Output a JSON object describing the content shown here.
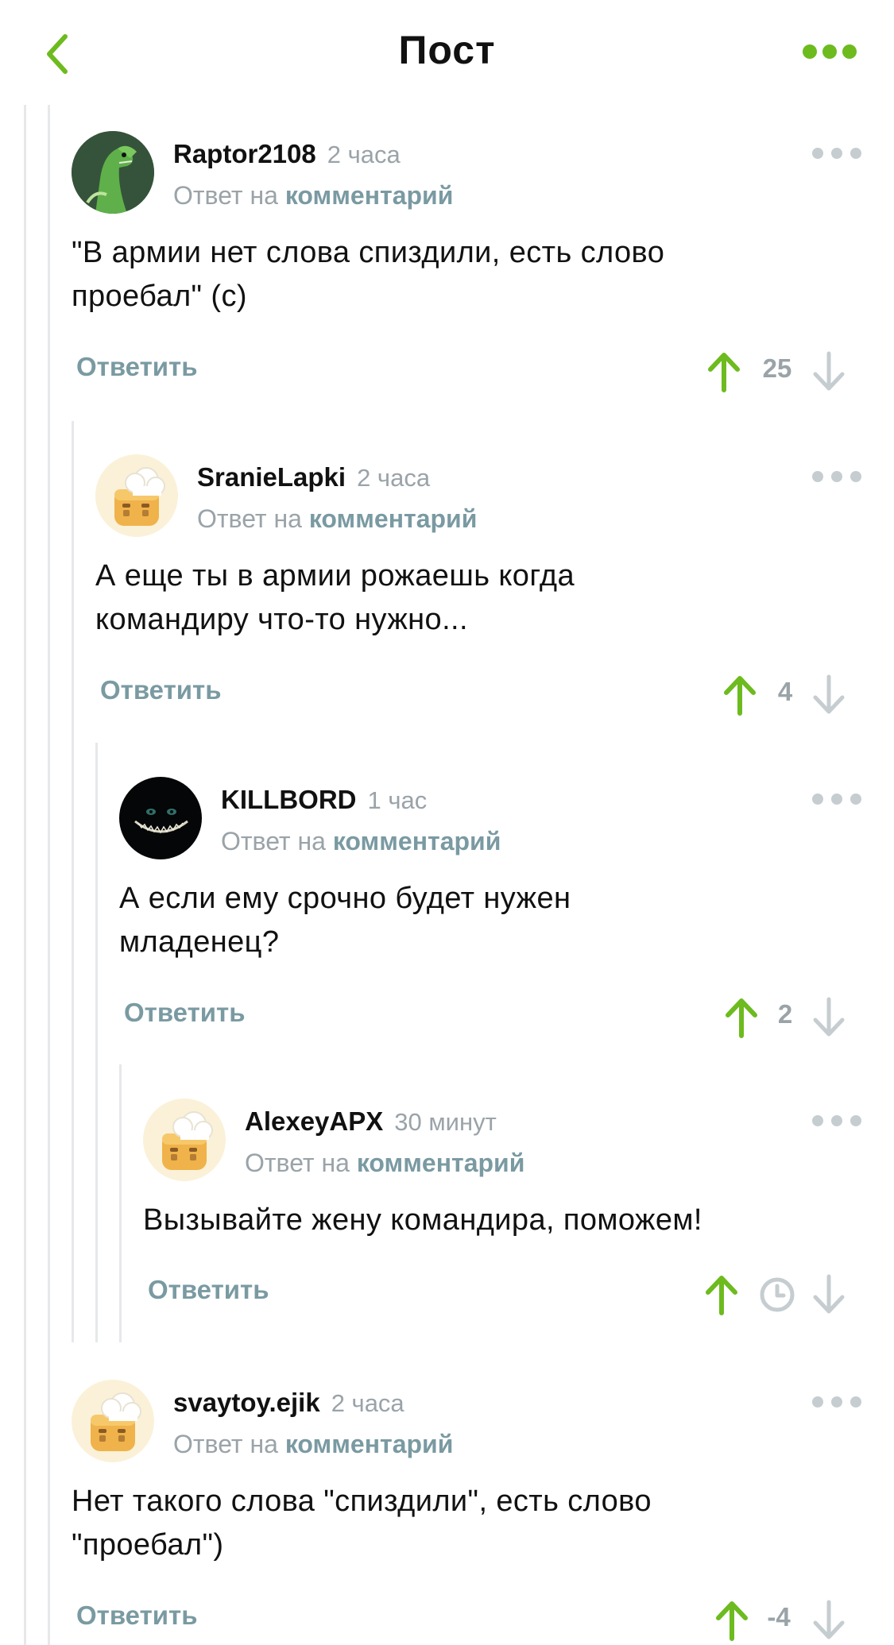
{
  "header": {
    "title": "Пост"
  },
  "colors": {
    "accent_green": "#6dbb1f",
    "muted_teal": "#7a9aa2",
    "muted_gray": "#9aa3a8",
    "thread_line": "#e6e8ea"
  },
  "comments": [
    {
      "username": "Raptor2108",
      "time": "2 часа",
      "reply_prefix": "Ответ на",
      "reply_link": "комментарий",
      "text_lines": [
        "\"В армии нет слова спиздили, есть слово",
        "проебал\" (с)"
      ],
      "reply_label": "Ответить",
      "rating": "25",
      "avatar": "dinosaur-avatar"
    },
    {
      "username": "SranieLapki",
      "time": "2 часа",
      "reply_prefix": "Ответ на",
      "reply_link": "комментарий",
      "text_lines": [
        "А еще ты в армии рожаешь когда",
        "командиру что-то нужно..."
      ],
      "reply_label": "Ответить",
      "rating": "4",
      "avatar": "default-chef-avatar"
    },
    {
      "username": "KILLBORD",
      "time": "1 час",
      "reply_prefix": "Ответ на",
      "reply_link": "комментарий",
      "text_lines": [
        "А если ему срочно будет нужен",
        "младенец?"
      ],
      "reply_label": "Ответить",
      "rating": "2",
      "avatar": "dark-smile-avatar"
    },
    {
      "username": "AlexeyAPX",
      "time": "30 минут",
      "reply_prefix": "Ответ на",
      "reply_link": "комментарий",
      "text_lines": [
        "Вызывайте жену командира, поможем!"
      ],
      "reply_label": "Ответить",
      "rating_icon": "clock-icon",
      "avatar": "default-chef-avatar"
    },
    {
      "username": "svaytoy.ejik",
      "time": "2 часа",
      "reply_prefix": "Ответ на",
      "reply_link": "комментарий",
      "text_lines": [
        "Нет такого слова \"спиздили\", есть слово",
        "\"проебал\")"
      ],
      "reply_label": "Ответить",
      "rating": "-4",
      "avatar": "default-chef-avatar"
    }
  ]
}
